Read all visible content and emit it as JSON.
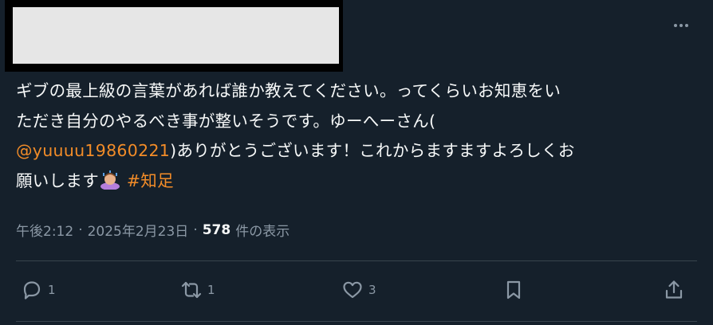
{
  "tweet": {
    "body": {
      "line1": "ギブの最上級の言葉があれば誰か教えてください。ってくらいお知恵をい",
      "line2": "ただき自分のやるべき事が整いそうです。ゆーへーさん(",
      "mention": "@yuuuu19860221",
      "line3_rest": ")ありがとうございます！これからますますよろしくお",
      "line4": "願いします",
      "hashtag": "#知足"
    },
    "meta": {
      "time": "午後2:12",
      "separator": "·",
      "date": "2025年2月23日",
      "views_count": "578",
      "views_label": "件の表示"
    },
    "actions": {
      "reply_count": "1",
      "retweet_count": "1",
      "like_count": "3",
      "bookmark_count": "",
      "share_count": ""
    },
    "icons": {
      "more": "more-icon",
      "reply": "reply-icon",
      "retweet": "retweet-icon",
      "like": "heart-icon",
      "bookmark": "bookmark-icon",
      "share": "share-icon",
      "emoji": "person-bowing-emoji"
    },
    "colors": {
      "background": "#15202b",
      "text": "#f7f9f9",
      "muted": "#8b98a5",
      "accent": "#f28c28",
      "divider": "#38444d"
    }
  }
}
